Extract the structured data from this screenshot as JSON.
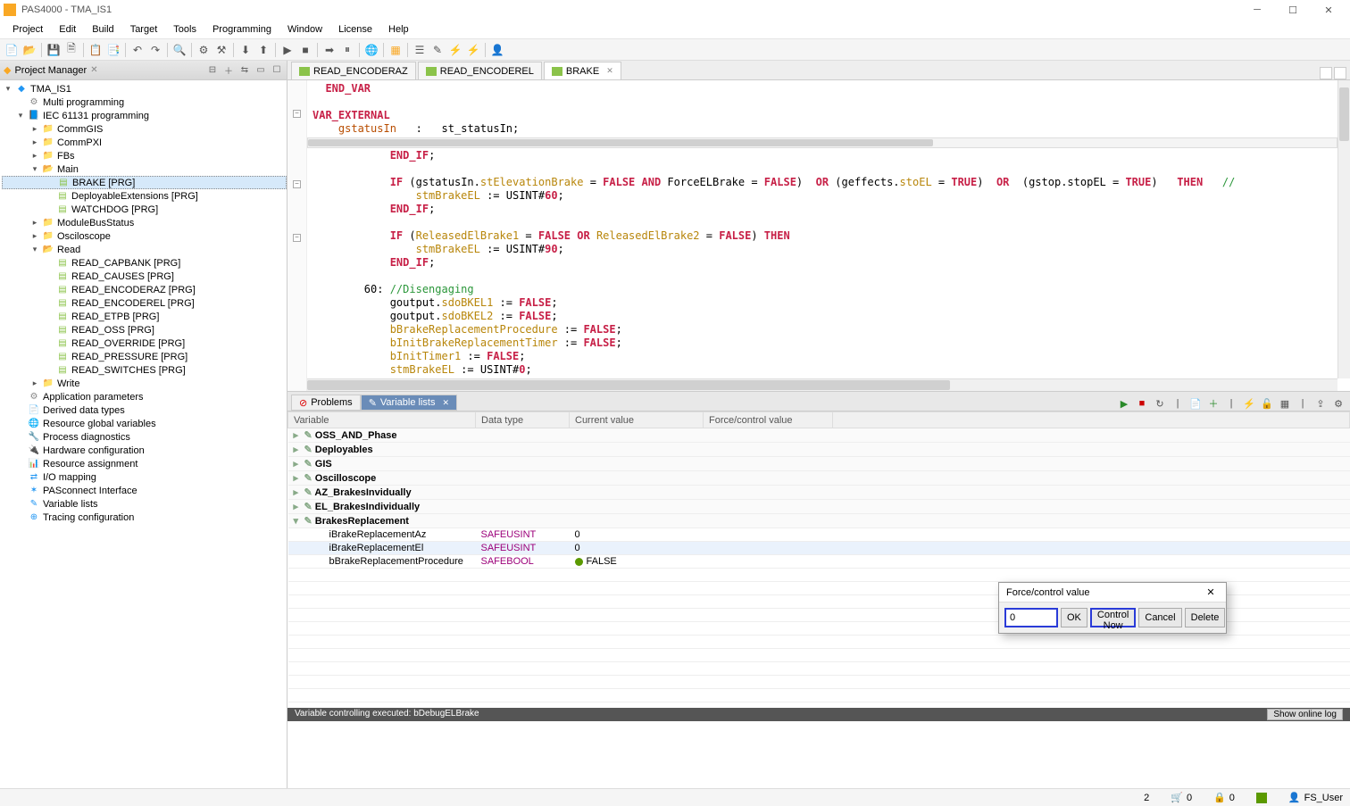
{
  "window": {
    "title": "PAS4000 - TMA_IS1"
  },
  "menu": [
    "Project",
    "Edit",
    "Build",
    "Target",
    "Tools",
    "Programming",
    "Window",
    "License",
    "Help"
  ],
  "projectManager": {
    "title": "Project Manager",
    "root": "TMA_IS1",
    "nodes": {
      "multiprog": "Multi programming",
      "iec": "IEC 61131 programming",
      "commGIS": "CommGIS",
      "commPXI": "CommPXI",
      "fbs": "FBs",
      "main": "Main",
      "brake": "BRAKE [PRG]",
      "deployExt": "DeployableExtensions [PRG]",
      "watchdog": "WATCHDOG [PRG]",
      "moduleBus": "ModuleBusStatus",
      "oscilo": "Osciloscope",
      "read": "Read",
      "read_capbank": "READ_CAPBANK [PRG]",
      "read_causes": "READ_CAUSES [PRG]",
      "read_encoderaz": "READ_ENCODERAZ [PRG]",
      "read_encoderel": "READ_ENCODEREL [PRG]",
      "read_etpb": "READ_ETPB [PRG]",
      "read_oss": "READ_OSS [PRG]",
      "read_override": "READ_OVERRIDE [PRG]",
      "read_pressure": "READ_PRESSURE [PRG]",
      "read_switches": "READ_SWITCHES [PRG]",
      "write": "Write",
      "appParams": "Application parameters",
      "derivedTypes": "Derived data types",
      "resGlobals": "Resource global variables",
      "procDiag": "Process diagnostics",
      "hwConfig": "Hardware configuration",
      "resAssign": "Resource assignment",
      "ioMap": "I/O mapping",
      "pasconnect": "PASconnect Interface",
      "varLists": "Variable lists",
      "tracing": "Tracing configuration"
    }
  },
  "editorTabs": [
    {
      "label": "READ_ENCODERAZ"
    },
    {
      "label": "READ_ENCODEREL"
    },
    {
      "label": "BRAKE",
      "active": true,
      "closeable": true
    }
  ],
  "code": {
    "l1": "END_VAR",
    "l2": "VAR_EXTERNAL",
    "l3a": "gstatusIn",
    "l3b": ":",
    "l3c": "st_statusIn;",
    "l4": "END_IF",
    "l5a": "IF",
    "l5b": "(gstatusIn.",
    "l5c": "stElevationBrake",
    "l5d": " = ",
    "l5false": "FALSE",
    "l5and": "AND",
    "l5e": " ForceELBrake = ",
    "l5or": "OR",
    "l5f": " (geffects.",
    "l5g": "stoEL",
    "l5h": " = ",
    "l5true": "TRUE",
    "l5i": ")  ",
    "l5j": "  (gstop.stopEL = ",
    "l5k": ")  ",
    "l5then": "THEN",
    "l5cmt": "//",
    "l6a": "stmBrakeEL",
    "l6b": " := USINT#",
    "l6c": "60",
    "l6d": ";",
    "l7a": "IF",
    "l7b": " (",
    "l7c": "ReleasedElBrake1",
    "l7d": " = ",
    "l7e": "FALSE",
    "l7f": " ",
    "l7or": "OR",
    "l7g": " ",
    "l7h": "ReleasedElBrake2",
    "l7i": " = ",
    "l7j": "FALSE",
    "l7k": ") ",
    "l7then": "THEN",
    "l8a": "stmBrakeEL",
    "l8b": " := USINT#",
    "l8c": "90",
    "l8d": ";",
    "l9": "60",
    "l9b": ": ",
    "l9c": "//Disengaging",
    "l10a": "goutput.",
    "l10b": "sdoBKEL1",
    "l10c": " := ",
    "l10d": "FALSE",
    "l10e": ";",
    "l11a": "goutput.",
    "l11b": "sdoBKEL2",
    "l11c": " := ",
    "l11d": "FALSE",
    "l11e": ";",
    "l12a": "bBrakeReplacementProcedure",
    "l12b": " := ",
    "l12c": "FALSE",
    "l12d": ";",
    "l13a": "bInitBrakeReplacementTimer",
    "l13b": " := ",
    "l13c": "FALSE",
    "l13d": ";",
    "l14a": "bInitTimer1",
    "l14b": " := ",
    "l14c": "FALSE",
    "l14d": ";",
    "l15a": "stmBrakeEL",
    "l15b": " := USINT#",
    "l15c": "0",
    "l15d": ";"
  },
  "bottomTabs": {
    "problems": "Problems",
    "varlists": "Variable lists"
  },
  "varTable": {
    "headers": [
      "Variable",
      "Data type",
      "Current value",
      "Force/control value"
    ],
    "groups": [
      "OSS_AND_Phase",
      "Deployables",
      "GIS",
      "Oscilloscope",
      "AZ_BrakesInvidually",
      "EL_BrakesIndividually",
      "BrakesReplacement"
    ],
    "rows": [
      {
        "name": "iBrakeReplacementAz",
        "type": "SAFEUSINT",
        "cur": "0"
      },
      {
        "name": "iBrakeReplacementEl",
        "type": "SAFEUSINT",
        "cur": "0"
      },
      {
        "name": "bBrakeReplacementProcedure",
        "type": "SAFEBOOL",
        "cur": "FALSE",
        "led": true
      }
    ]
  },
  "dialog": {
    "title": "Force/control value",
    "value": "0",
    "ok": "OK",
    "controlNow": "Control Now",
    "cancel": "Cancel",
    "delete": "Delete"
  },
  "statusLine": {
    "msg": "Variable controlling executed: bDebugELBrake",
    "btn": "Show online log"
  },
  "statusBar": {
    "num1": "2",
    "num2": "0",
    "num3": "0",
    "user": "FS_User"
  }
}
